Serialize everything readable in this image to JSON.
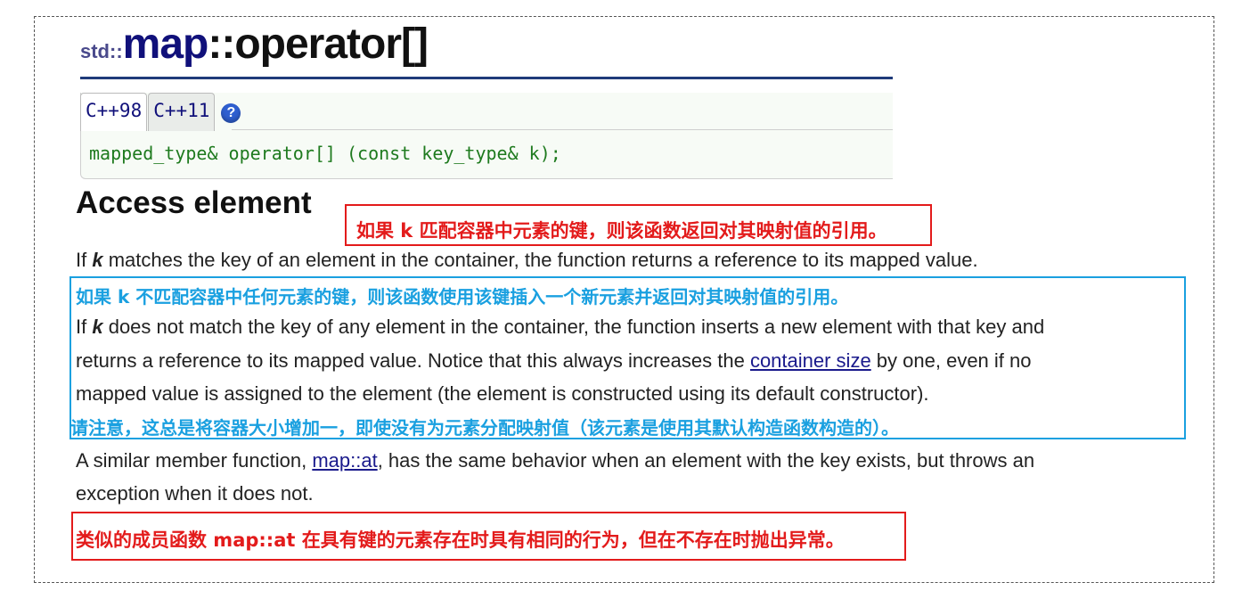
{
  "title": {
    "namespace": "std::",
    "class_name": "map",
    "operator": "::operator[]"
  },
  "tabs": [
    {
      "label": "C++98",
      "active": true
    },
    {
      "label": "C++11",
      "active": false
    }
  ],
  "help_icon": {
    "glyph": "?",
    "icon": "help-icon"
  },
  "declaration": "mapped_type& operator[] (const key_type& k);",
  "section_heading": "Access element",
  "paragraphs": {
    "p1": {
      "pre": "If ",
      "param": "k",
      "post": " matches the key of an element in the container, the function returns a reference to its mapped value."
    },
    "p2": {
      "line1_pre": "If ",
      "param": "k",
      "line1_post": " does not match the key of any element in the container, the function inserts a new element with that key and",
      "line2_pre": "returns a reference to its mapped value. Notice that this always increases the ",
      "link": "container size",
      "line2_post": " by one, even if no",
      "line3": "mapped value is assigned to the element (the element is constructed using its default constructor)."
    },
    "p3": {
      "pre": "A similar member function, ",
      "link": "map::at",
      "post": ", has the same behavior when an element with the key exists, but throws an",
      "line2": "exception when it does not."
    }
  },
  "annotations": {
    "red_1": "如果 k 匹配容器中元素的键，则该函数返回对其映射值的引用。",
    "blue_1": "如果 k 不匹配容器中任何元素的键，则该函数使用该键插入一个新元素并返回对其映射值的引用。",
    "blue_2": "请注意，这总是将容器大小增加一，即使没有为元素分配映射值（该元素是使用其默认构造函数构造的）。",
    "red_2": "类似的成员函数 map::at 在具有键的元素存在时具有相同的行为，但在不存在时抛出异常。"
  },
  "colors": {
    "annotation_red": "#e31b1b",
    "annotation_blue": "#1aa0e0",
    "code_green": "#1e7a1e",
    "title_navy": "#10107a",
    "link": "#1a1a8c"
  }
}
